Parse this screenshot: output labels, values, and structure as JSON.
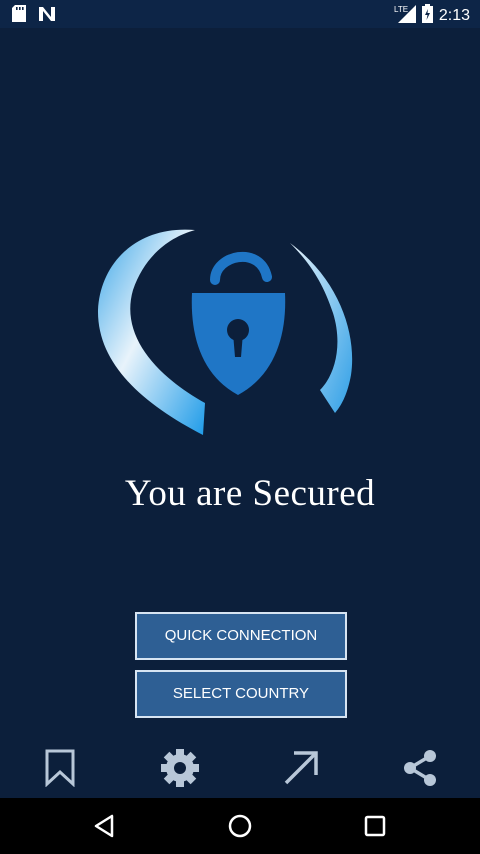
{
  "status_bar": {
    "time": "2:13",
    "network_label": "LTE",
    "icons": [
      "sd-card-icon",
      "n-notification-icon",
      "lte-signal-icon",
      "battery-icon"
    ]
  },
  "main": {
    "headline": "You are Secured",
    "logo_icon": "lock-shield-icon"
  },
  "buttons": {
    "quick_connection": "QUICK CONNECTION",
    "select_country": "SELECT COUNTRY"
  },
  "actions": [
    {
      "icon": "bookmark-icon"
    },
    {
      "icon": "gear-icon"
    },
    {
      "icon": "arrow-up-right-icon"
    },
    {
      "icon": "share-icon"
    }
  ],
  "nav": [
    "back-icon",
    "home-icon",
    "recents-icon"
  ],
  "colors": {
    "background": "#0c1f3b",
    "status_bar": "#0d2547",
    "button_fill": "#2e5f94",
    "button_border": "#d7e4f2",
    "accent_blue": "#1f76c6"
  }
}
